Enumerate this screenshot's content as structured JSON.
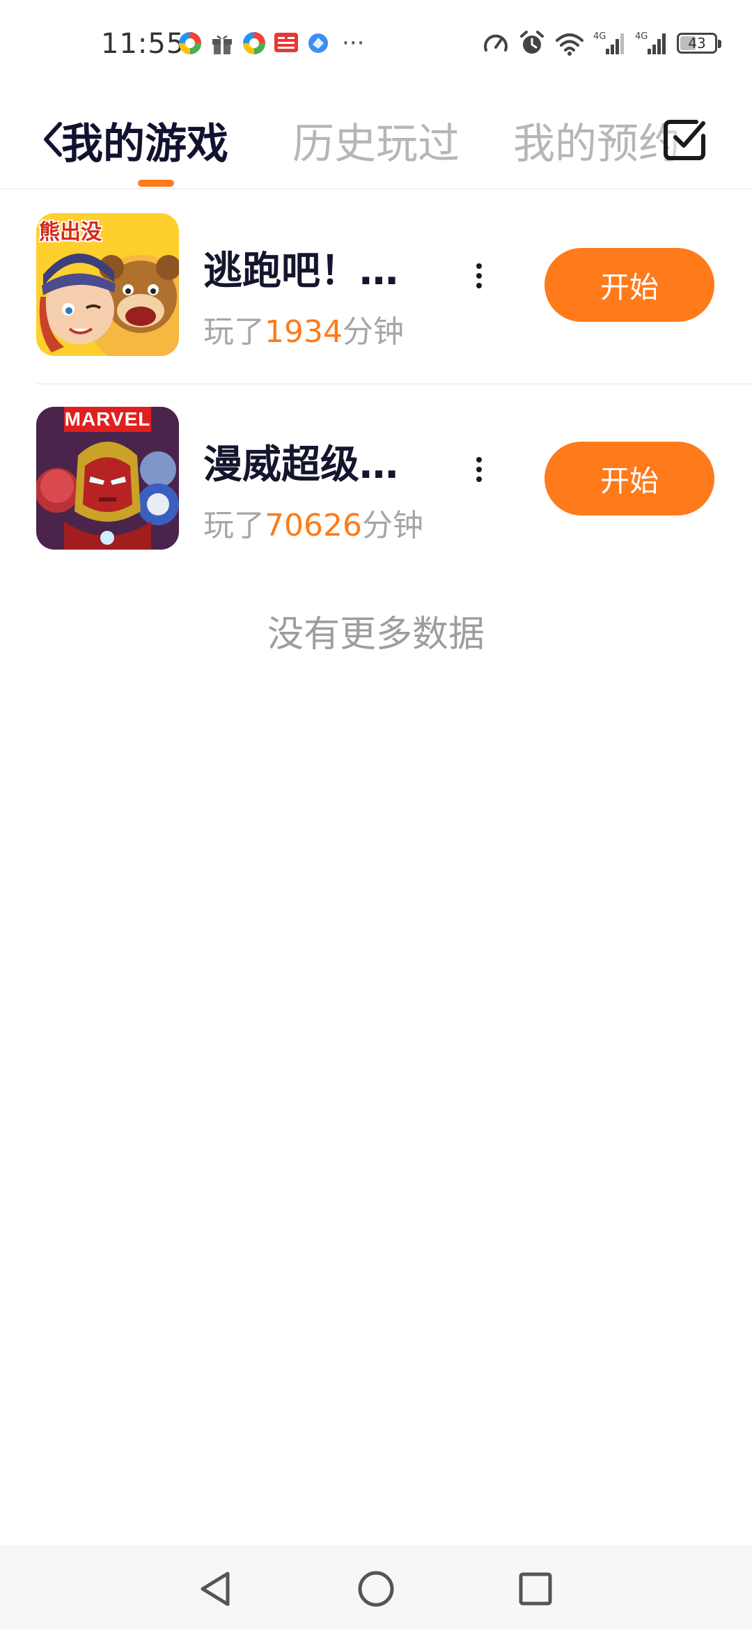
{
  "status_bar": {
    "time": "11:55",
    "notification_icons": [
      "colorful-app-icon",
      "gift-icon",
      "colorful-app-icon",
      "toutiao-icon",
      "browser-icon"
    ],
    "more_indicator": "···",
    "system_icons": [
      "speed-icon",
      "alarm-icon",
      "wifi-icon",
      "signal-4g-icon",
      "signal-4g-icon"
    ],
    "network_label": "4G",
    "battery_level": "43"
  },
  "header": {
    "tabs": [
      {
        "label": "我的游戏",
        "active": true
      },
      {
        "label": "历史玩过",
        "active": false
      },
      {
        "label": "我的预约",
        "active": false
      }
    ],
    "accent_color": "#ff7a1a"
  },
  "games": [
    {
      "name": "逃跑吧！…",
      "played_prefix": "玩了",
      "minutes": "1934",
      "played_suffix": "分钟",
      "start_label": "开始",
      "icon": "bear-game-icon",
      "icon_badge": "熊出没"
    },
    {
      "name": "漫威超级…",
      "played_prefix": "玩了",
      "minutes": "70626",
      "played_suffix": "分钟",
      "start_label": "开始",
      "icon": "marvel-game-icon",
      "icon_badge": "MARVEL"
    }
  ],
  "footer": {
    "no_more": "没有更多数据"
  },
  "nav": {
    "icons": [
      "back-triangle-icon",
      "home-circle-icon",
      "recent-square-icon"
    ]
  }
}
